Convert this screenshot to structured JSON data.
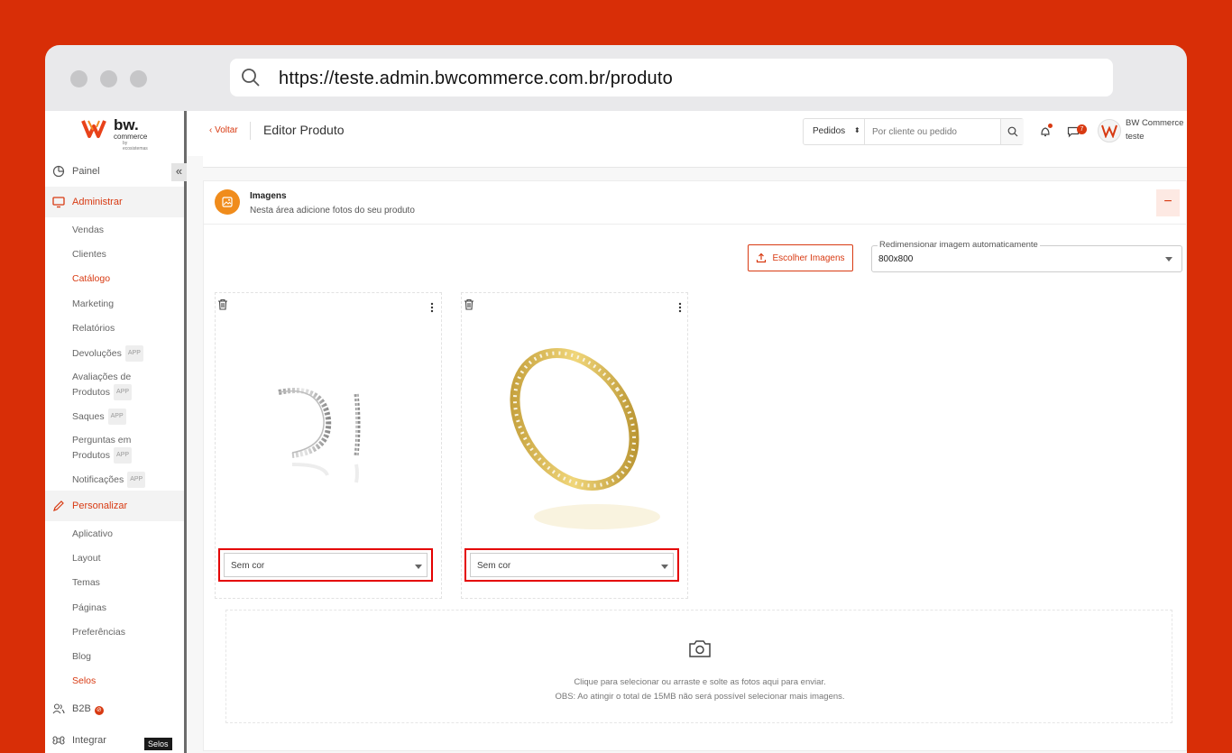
{
  "browser": {
    "url": "https://teste.admin.bwcommerce.com.br/produto"
  },
  "logo": {
    "brand": "bw.",
    "sub": "commerce",
    "by": "by ecosistemas"
  },
  "sidebar": {
    "collapse_glyph": "«",
    "painel": "Painel",
    "administrar": "Administrar",
    "admin_items": [
      "Vendas",
      "Clientes",
      "Catálogo",
      "Marketing",
      "Relatórios"
    ],
    "devolucoes": "Devoluções",
    "avaliacoes_line1": "Avaliações de",
    "avaliacoes_line2": "Produtos",
    "saques": "Saques",
    "perguntas_line1": "Perguntas em",
    "perguntas_line2": "Produtos",
    "notificacoes": "Notificações",
    "app_badge": "APP",
    "personalizar": "Personalizar",
    "personalizar_items": [
      "Aplicativo",
      "Layout",
      "Temas",
      "Páginas",
      "Preferências",
      "Blog",
      "Selos"
    ],
    "b2b": "B2B",
    "integrar": "Integrar",
    "tooltip": "Selos"
  },
  "header": {
    "back": "Voltar",
    "title": "Editor Produto",
    "search_select": "Pedidos",
    "search_placeholder": "Por cliente ou pedido",
    "chat_count": "7",
    "user_name": "BW Commerce",
    "user_store": "teste"
  },
  "images_section": {
    "title": "Imagens",
    "subtitle": "Nesta área adicione fotos do seu produto",
    "collapse_glyph": "−",
    "choose_button": "Escolher Imagens",
    "resize_label": "Redimensionar imagem automaticamente",
    "resize_value": "800x800",
    "images": [
      {
        "color": "Sem cor"
      },
      {
        "color": "Sem cor"
      }
    ],
    "dropzone_line1": "Clique para selecionar ou arraste e solte as fotos aqui para enviar.",
    "dropzone_line2": "OBS: Ao atingir o total de 15MB não será possível selecionar mais imagens."
  },
  "colors": {
    "accent": "#d83a12",
    "background": "#d82e07",
    "highlight": "#e40000",
    "icon_orange": "#f08c1c"
  },
  "icons": [
    "search-icon",
    "chevron-left-icon",
    "bell-icon",
    "chat-icon",
    "upload-icon",
    "trash-icon",
    "kebab-icon",
    "camera-icon",
    "image-icon",
    "pie-chart-icon",
    "monitor-icon",
    "pencil-icon",
    "users-icon",
    "command-icon"
  ]
}
